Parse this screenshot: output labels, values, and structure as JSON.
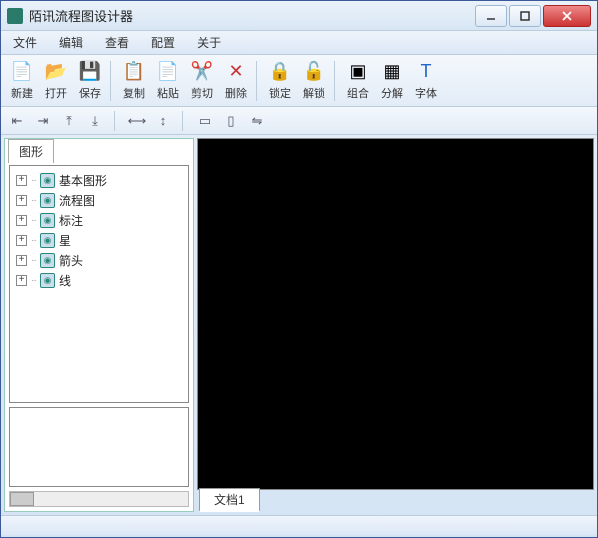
{
  "window": {
    "title": "陌讯流程图设计器"
  },
  "menu": {
    "file": "文件",
    "edit": "编辑",
    "view": "查看",
    "config": "配置",
    "about": "关于"
  },
  "toolbar": {
    "new": "新建",
    "open": "打开",
    "save": "保存",
    "copy": "复制",
    "paste": "粘贴",
    "cut": "剪切",
    "delete": "删除",
    "lock": "锁定",
    "unlock": "解锁",
    "group": "组合",
    "ungroup": "分解",
    "font": "字体"
  },
  "sidebar": {
    "tab": "图形",
    "items": [
      {
        "label": "基本图形"
      },
      {
        "label": "流程图"
      },
      {
        "label": "标注"
      },
      {
        "label": "星"
      },
      {
        "label": "箭头"
      },
      {
        "label": "线"
      }
    ]
  },
  "document": {
    "tab1": "文档1"
  }
}
